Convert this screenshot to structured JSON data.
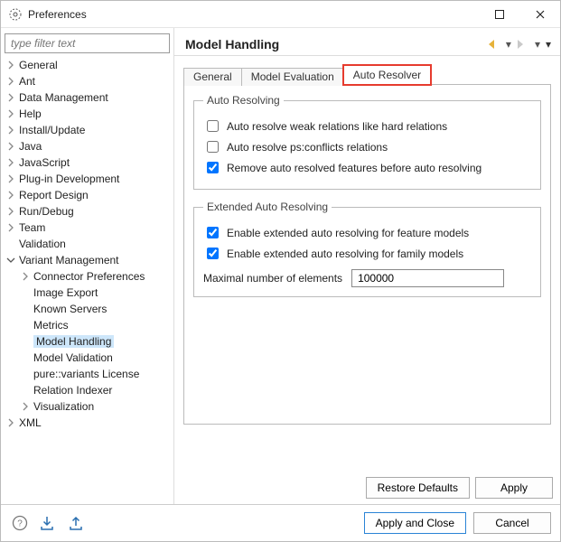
{
  "window": {
    "title": "Preferences"
  },
  "sidebar": {
    "search_placeholder": "type filter text",
    "items": [
      {
        "label": "General",
        "expandable": true,
        "expanded": false
      },
      {
        "label": "Ant",
        "expandable": true,
        "expanded": false
      },
      {
        "label": "Data Management",
        "expandable": true,
        "expanded": false
      },
      {
        "label": "Help",
        "expandable": true,
        "expanded": false
      },
      {
        "label": "Install/Update",
        "expandable": true,
        "expanded": false
      },
      {
        "label": "Java",
        "expandable": true,
        "expanded": false
      },
      {
        "label": "JavaScript",
        "expandable": true,
        "expanded": false
      },
      {
        "label": "Plug-in Development",
        "expandable": true,
        "expanded": false
      },
      {
        "label": "Report Design",
        "expandable": true,
        "expanded": false
      },
      {
        "label": "Run/Debug",
        "expandable": true,
        "expanded": false
      },
      {
        "label": "Team",
        "expandable": true,
        "expanded": false
      },
      {
        "label": "Validation",
        "expandable": false
      },
      {
        "label": "Variant Management",
        "expandable": true,
        "expanded": true,
        "children": [
          {
            "label": "Connector Preferences",
            "expandable": true,
            "expanded": false
          },
          {
            "label": "Image Export"
          },
          {
            "label": "Known Servers"
          },
          {
            "label": "Metrics"
          },
          {
            "label": "Model Handling",
            "selected": true
          },
          {
            "label": "Model Validation"
          },
          {
            "label": "pure::variants License"
          },
          {
            "label": "Relation Indexer"
          },
          {
            "label": "Visualization",
            "expandable": true,
            "expanded": false
          }
        ]
      },
      {
        "label": "XML",
        "expandable": true,
        "expanded": false
      }
    ]
  },
  "page": {
    "title": "Model Handling",
    "tabs": [
      {
        "label": "General",
        "active": false
      },
      {
        "label": "Model Evaluation",
        "active": false
      },
      {
        "label": "Auto Resolver",
        "active": true,
        "highlight": true
      }
    ],
    "group_auto": {
      "legend": "Auto Resolving",
      "opt1": {
        "label": "Auto resolve weak relations like hard relations",
        "checked": false
      },
      "opt2": {
        "label": "Auto resolve ps:conflicts relations",
        "checked": false
      },
      "opt3": {
        "label": "Remove auto resolved features before auto resolving",
        "checked": true
      }
    },
    "group_ext": {
      "legend": "Extended Auto Resolving",
      "opt1": {
        "label": "Enable extended auto resolving for feature models",
        "checked": true
      },
      "opt2": {
        "label": "Enable extended auto resolving for family models",
        "checked": true
      },
      "max_label": "Maximal number of elements",
      "max_value": "100000"
    },
    "buttons": {
      "restore": "Restore Defaults",
      "apply": "Apply"
    }
  },
  "footer": {
    "apply_close": "Apply and Close",
    "cancel": "Cancel"
  }
}
